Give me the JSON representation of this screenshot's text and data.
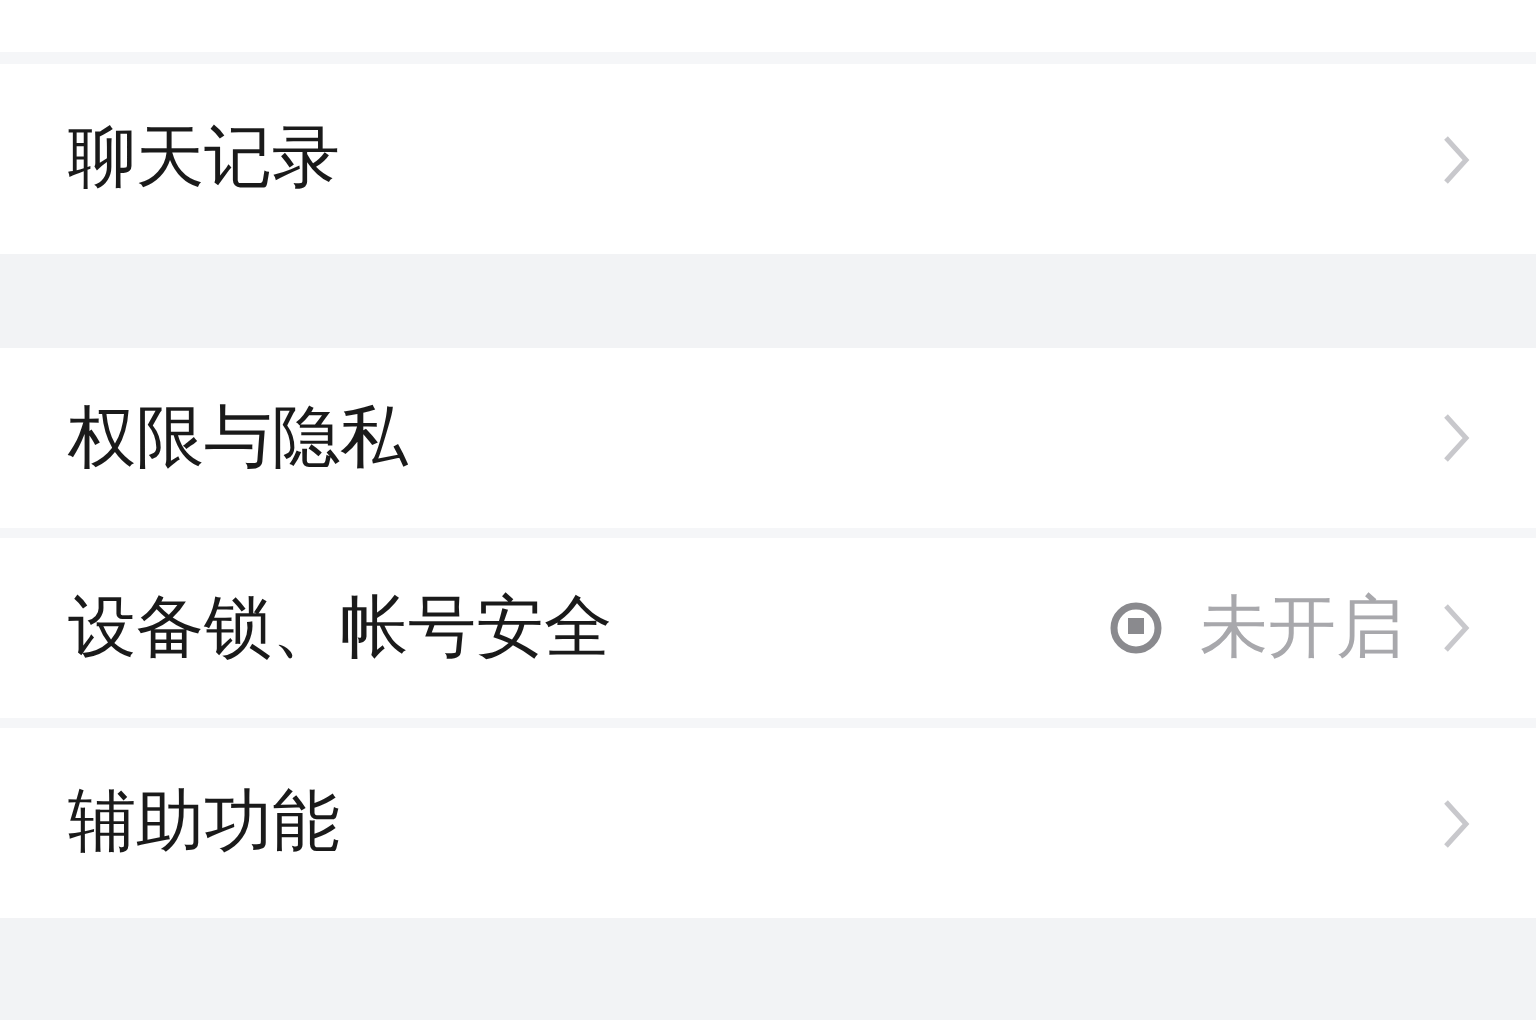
{
  "groups": [
    {
      "rows": [
        {
          "label": "聊天记录"
        }
      ]
    },
    {
      "rows": [
        {
          "label": "权限与隐私"
        },
        {
          "label": "设备锁、帐号安全",
          "status": "未开启"
        },
        {
          "label": "辅助功能"
        }
      ]
    }
  ]
}
